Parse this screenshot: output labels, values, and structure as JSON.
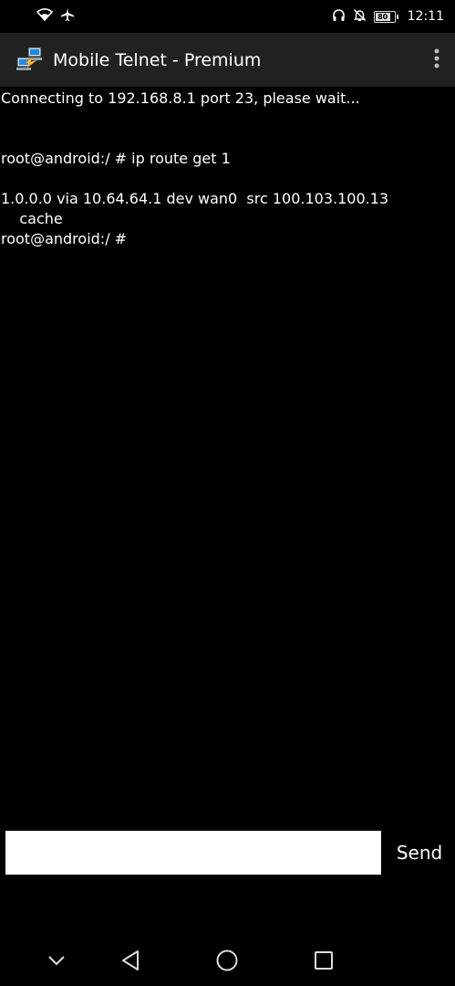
{
  "status_bar": {
    "battery_level": "80",
    "battery_fraction": 0.8,
    "time": "12:11",
    "icons": [
      "wifi-icon",
      "airplane-icon",
      "headphones-icon",
      "bell-off-icon",
      "battery-icon"
    ]
  },
  "app_bar": {
    "title": "Mobile Telnet - Premium",
    "icon": "network-computers-icon",
    "menu_icon": "more-vertical-icon"
  },
  "terminal": {
    "lines": [
      "Connecting to 192.168.8.1 port 23, please wait...",
      "",
      "",
      "root@android:/ # ip route get 1",
      "",
      "1.0.0.0 via 10.64.64.1 dev wan0  src 100.103.100.13",
      "    cache",
      "root@android:/ #"
    ]
  },
  "input_bar": {
    "value": "",
    "placeholder": "",
    "send_label": "Send"
  },
  "nav_bar": {
    "icons": [
      "chevron-down-icon",
      "back-icon",
      "home-icon",
      "recents-icon"
    ]
  },
  "colors": {
    "background": "#000000",
    "app_bar": "#212121",
    "text": "#ffffff",
    "input_bg": "#ffffff"
  }
}
